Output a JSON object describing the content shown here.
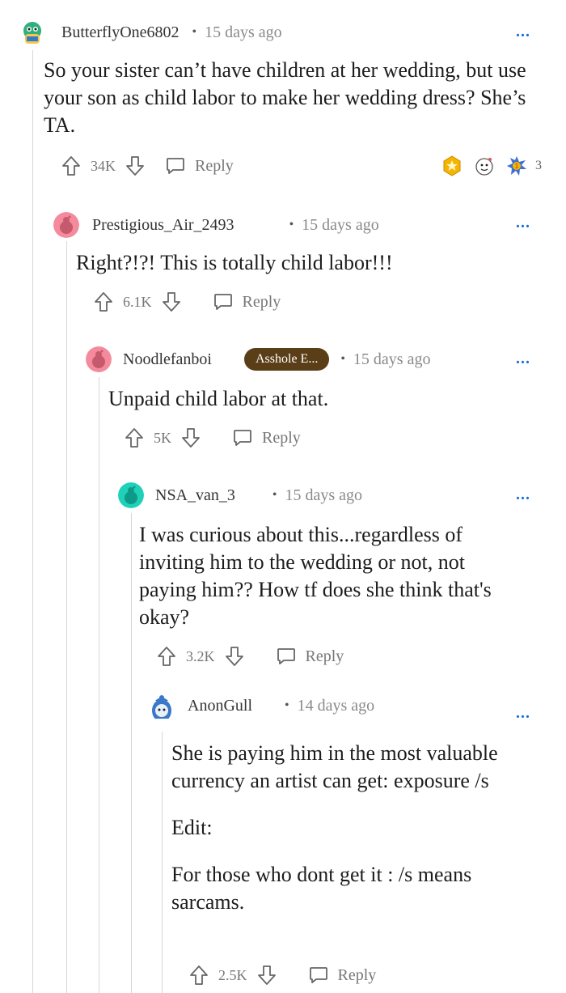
{
  "colors": {
    "flair_bg": "#5a3e17",
    "more_dots": "#1a6fd4",
    "thread_line": "#d6d6d6"
  },
  "comments": [
    {
      "username": "ButterflyOne6802",
      "dot": "•",
      "time": "15 days ago",
      "more": "...",
      "body": [
        "So your sister can’t have children at her wedding, but use your son as child labor to make her wedding dress? She’s TA."
      ],
      "score": "34K",
      "reply_label": "Reply",
      "awards": [
        "gold-star-award-icon",
        "hug-award-icon",
        "starstruck-award-icon"
      ],
      "award_count": "3",
      "avatar_color": "#2fae7e"
    },
    {
      "username": "Prestigious_Air_2493",
      "dot": "•",
      "time": "15 days ago",
      "more": "...",
      "body": [
        "Right?!?! This is totally child labor!!!"
      ],
      "score": "6.1K",
      "reply_label": "Reply",
      "avatar_color": "#f48a9c"
    },
    {
      "username": "Noodlefanboi",
      "flair": "Asshole E...",
      "dot": "•",
      "time": "15 days ago",
      "more": "...",
      "body": [
        "Unpaid child labor at that."
      ],
      "score": "5K",
      "reply_label": "Reply",
      "avatar_color": "#f48a9c"
    },
    {
      "username": "NSA_van_3",
      "dot": "•",
      "time": "15 days ago",
      "more": "...",
      "body": [
        "I was curious about this...regardless of inviting him to the wedding or not, not paying him?? How tf does she think that's okay?"
      ],
      "score": "3.2K",
      "reply_label": "Reply",
      "avatar_color": "#1fd1b8"
    },
    {
      "username": "AnonGull",
      "dot": "•",
      "time": "14 days ago",
      "more": "...",
      "body": [
        "She is paying him in the most valuable currency an artist can get: exposure /s",
        "Edit:",
        "For those who dont get it : /s means sarcams."
      ],
      "score": "2.5K",
      "reply_label": "Reply",
      "avatar_color": "#3b78c8"
    }
  ]
}
